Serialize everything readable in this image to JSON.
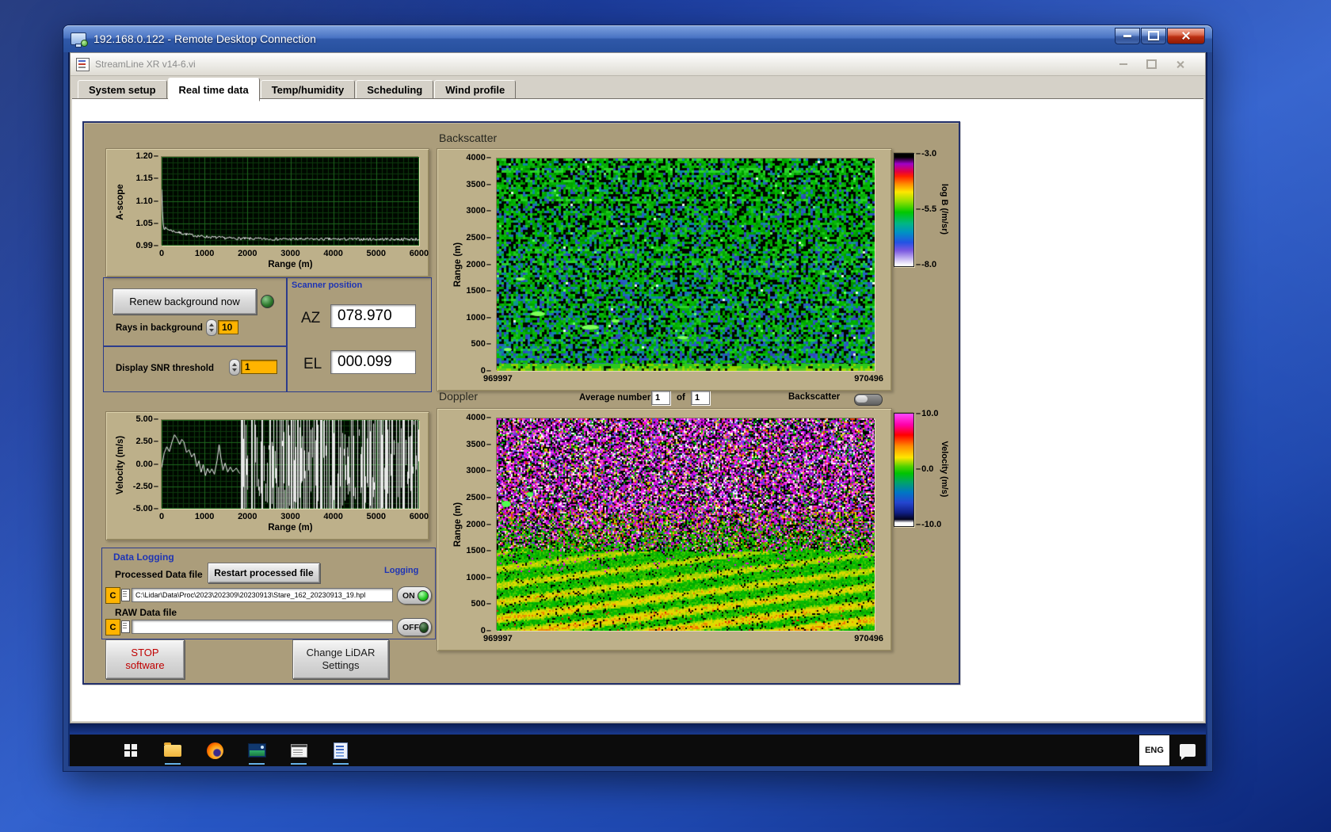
{
  "rdp": {
    "title": "192.168.0.122 - Remote Desktop Connection"
  },
  "app": {
    "title": "StreamLine XR v14-6.vi",
    "tabs": [
      {
        "label": "System setup"
      },
      {
        "label": "Real time data"
      },
      {
        "label": "Temp/humidity"
      },
      {
        "label": "Scheduling"
      },
      {
        "label": "Wind profile"
      }
    ]
  },
  "panel": {
    "ascope": {
      "ylabel": "A-scope",
      "xlabel": "Range (m)",
      "yticks": [
        "1.20",
        "1.15",
        "1.10",
        "1.05",
        "0.99"
      ],
      "xticks": [
        "0",
        "1000",
        "2000",
        "3000",
        "4000",
        "5000",
        "6000"
      ]
    },
    "velocity_graph": {
      "ylabel": "Velocity (m/s)",
      "xlabel": "Range (m)",
      "yticks": [
        "5.00",
        "2.50",
        "0.00",
        "-2.50",
        "-5.00"
      ],
      "xticks": [
        "0",
        "1000",
        "2000",
        "3000",
        "4000",
        "5000",
        "6000"
      ]
    },
    "background_group": {
      "renew_button": "Renew background now",
      "rays_label": "Rays in background",
      "rays_value": "10"
    },
    "snr_group": {
      "label": "Display SNR threshold",
      "value": "1"
    },
    "scanner": {
      "title": "Scanner position",
      "az_label": "AZ",
      "az_value": "078.970",
      "el_label": "EL",
      "el_value": "000.099"
    },
    "backscatter": {
      "title": "Backscatter",
      "ylabel": "Range (m)",
      "yticks": [
        "4000",
        "3500",
        "3000",
        "2500",
        "2000",
        "1500",
        "1000",
        "500",
        "0"
      ],
      "x_start": "969997",
      "x_end": "970496",
      "colorbar_ticks": [
        "-3.0",
        "-5.5",
        "-8.0"
      ],
      "colorbar_label": "log B (/m/sr)"
    },
    "doppler": {
      "title": "Doppler",
      "avg_label": "Average number",
      "avg_value": "1",
      "of_label": "of",
      "avg_total": "1",
      "toggle_label": "Backscatter",
      "ylabel": "Range (m)",
      "yticks": [
        "4000",
        "3500",
        "3000",
        "2500",
        "2000",
        "1500",
        "1000",
        "500",
        "0"
      ],
      "x_start": "969997",
      "x_end": "970496",
      "colorbar_ticks": [
        "10.0",
        "0.0",
        "-10.0"
      ],
      "colorbar_label": "Velocity (m/s)"
    },
    "logging": {
      "title": "Data Logging",
      "processed_label": "Processed Data file",
      "restart_button": "Restart processed file",
      "logging_label": "Logging",
      "drive": "C",
      "processed_path": "C:\\Lidar\\Data\\Proc\\2023\\202309\\20230913\\Stare_162_20230913_19.hpl",
      "raw_label": "RAW Data file",
      "raw_path": "",
      "on_label": "ON",
      "off_label": "OFF"
    },
    "stop_button": {
      "line1": "STOP",
      "line2": "software"
    },
    "change_button": {
      "line1": "Change LiDAR",
      "line2": "Settings"
    }
  },
  "taskbar": {
    "language": "ENG"
  },
  "colors": {
    "panel": "#ab9d7b",
    "group_border": "#2c3c8c",
    "blue_label": "#1e34b4",
    "field_orange": "#ffb400"
  }
}
